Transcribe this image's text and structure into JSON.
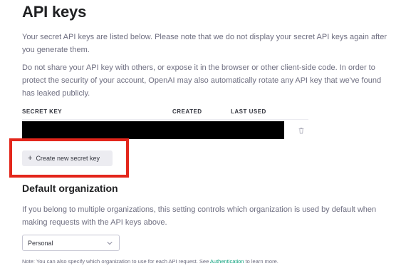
{
  "page": {
    "title": "API keys",
    "intro": "Your secret API keys are listed below. Please note that we do not display your secret API keys again after you generate them.",
    "warning": "Do not share your API key with others, or expose it in the browser or other client-side code. In order to protect the security of your account, OpenAI may also automatically rotate any API key that we've found has leaked publicly."
  },
  "keys_table": {
    "columns": [
      "SECRET KEY",
      "CREATED",
      "LAST USED"
    ],
    "rows_redacted": true,
    "delete_icon": "trash-icon"
  },
  "create_button": {
    "icon": "plus-icon",
    "label": "Create new secret key",
    "highlight_color": "#e3261b"
  },
  "default_org": {
    "title": "Default organization",
    "description": "If you belong to multiple organizations, this setting controls which organization is used by default when making requests with the API keys above.",
    "selected": "Personal",
    "note_prefix": "Note: You can also specify which organization to use for each API request. See ",
    "note_link": "Authentication",
    "note_suffix": " to learn more."
  },
  "colors": {
    "link": "#10a37f",
    "button_bg": "#ececf1"
  }
}
